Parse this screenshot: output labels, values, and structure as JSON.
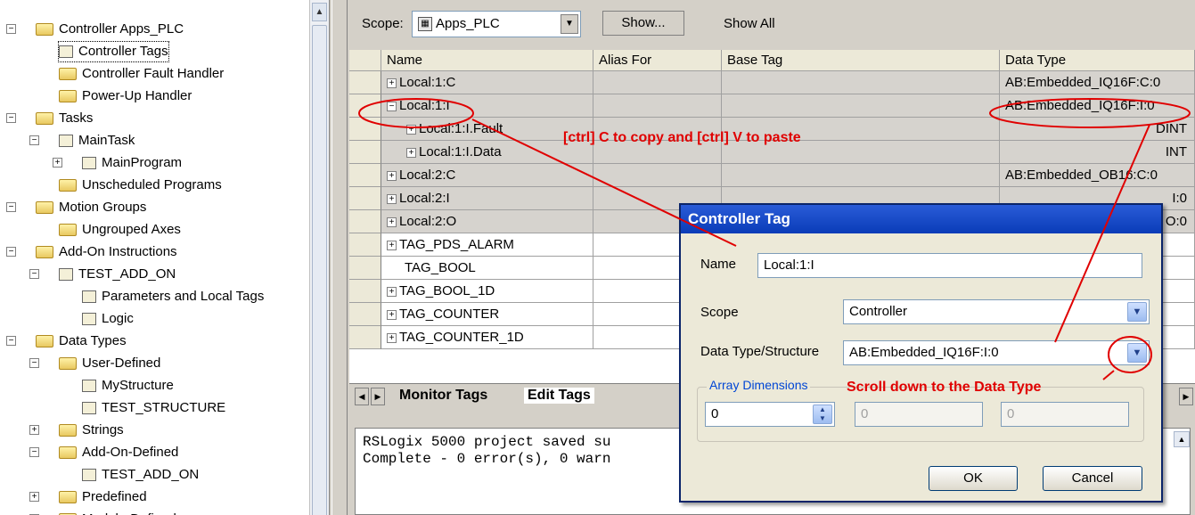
{
  "tree": {
    "items": [
      {
        "label": "Controller Apps_PLC",
        "level": 0,
        "box": "−",
        "icon": "folder-icon"
      },
      {
        "label": "Controller Tags",
        "level": 1,
        "icon": "tag-edit-icon",
        "selected": true
      },
      {
        "label": "Controller Fault Handler",
        "level": 1,
        "icon": "folder-icon"
      },
      {
        "label": "Power-Up Handler",
        "level": 1,
        "icon": "folder-icon"
      },
      {
        "label": "Tasks",
        "level": 0,
        "box": "−",
        "icon": "folder-icon"
      },
      {
        "label": "MainTask",
        "level": 1,
        "box": "−",
        "icon": "task-icon"
      },
      {
        "label": "MainProgram",
        "level": 2,
        "box": "+",
        "icon": "program-icon"
      },
      {
        "label": "Unscheduled Programs",
        "level": 1,
        "icon": "folder-icon"
      },
      {
        "label": "Motion Groups",
        "level": 0,
        "box": "−",
        "icon": "folder-icon"
      },
      {
        "label": "Ungrouped Axes",
        "level": 1,
        "icon": "folder-icon"
      },
      {
        "label": "Add-On Instructions",
        "level": 0,
        "box": "−",
        "icon": "folder-icon"
      },
      {
        "label": "TEST_ADD_ON",
        "level": 1,
        "box": "−",
        "icon": "aoi-icon"
      },
      {
        "label": "Parameters and Local Tags",
        "level": 2,
        "icon": "tag-edit-icon"
      },
      {
        "label": "Logic",
        "level": 2,
        "icon": "logic-icon"
      },
      {
        "label": "Data Types",
        "level": 0,
        "box": "−",
        "icon": "folder-icon"
      },
      {
        "label": "User-Defined",
        "level": 1,
        "box": "−",
        "icon": "datatype-folder-icon"
      },
      {
        "label": "MyStructure",
        "level": 2,
        "icon": "datatype-icon"
      },
      {
        "label": "TEST_STRUCTURE",
        "level": 2,
        "icon": "datatype-icon"
      },
      {
        "label": "Strings",
        "level": 1,
        "box": "+",
        "icon": "datatype-folder-icon"
      },
      {
        "label": "Add-On-Defined",
        "level": 1,
        "box": "−",
        "icon": "datatype-folder-icon"
      },
      {
        "label": "TEST_ADD_ON",
        "level": 2,
        "icon": "datatype-icon"
      },
      {
        "label": "Predefined",
        "level": 1,
        "box": "+",
        "icon": "datatype-folder-icon"
      },
      {
        "label": "Module-Defined",
        "level": 1,
        "box": "+",
        "icon": "datatype-folder-icon"
      }
    ]
  },
  "toolbar": {
    "scope_label": "Scope:",
    "scope_value": "Apps_PLC",
    "show_button": "Show...",
    "show_all": "Show All"
  },
  "grid": {
    "columns": [
      "Name",
      "Alias For",
      "Base Tag",
      "Data Type"
    ],
    "rows": [
      {
        "name": "Local:1:C",
        "box": "+",
        "indent": 0,
        "type": "AB:Embedded_IQ16F:C:0",
        "grey": true
      },
      {
        "name": "Local:1:I",
        "box": "−",
        "indent": 0,
        "type": "AB:Embedded_IQ16F:I:0",
        "grey": true
      },
      {
        "name": "Local:1:I.Fault",
        "box": "+",
        "indent": 1,
        "type": "DINT",
        "grey": true
      },
      {
        "name": "Local:1:I.Data",
        "box": "+",
        "indent": 1,
        "type": "INT",
        "grey": true
      },
      {
        "name": "Local:2:C",
        "box": "+",
        "indent": 0,
        "type": "AB:Embedded_OB16:C:0",
        "grey": true
      },
      {
        "name": "Local:2:I",
        "box": "+",
        "indent": 0,
        "type": "I:0",
        "grey": true
      },
      {
        "name": "Local:2:O",
        "box": "+",
        "indent": 0,
        "type": "O:0",
        "grey": true
      },
      {
        "name": "TAG_PDS_ALARM",
        "box": "+",
        "indent": 0,
        "type": "",
        "grey": false
      },
      {
        "name": "TAG_BOOL",
        "box": "",
        "indent": 0,
        "type": "",
        "grey": false
      },
      {
        "name": "TAG_BOOL_1D",
        "box": "+",
        "indent": 0,
        "type": "",
        "grey": false
      },
      {
        "name": "TAG_COUNTER",
        "box": "+",
        "indent": 0,
        "type": "",
        "grey": false
      },
      {
        "name": "TAG_COUNTER_1D",
        "box": "+",
        "indent": 0,
        "type": "",
        "grey": false
      }
    ]
  },
  "tabs": {
    "monitor": "Monitor Tags",
    "edit": "Edit Tags"
  },
  "output": {
    "line1": "RSLogix 5000 project saved su",
    "line2": "Complete - 0 error(s), 0 warn"
  },
  "dialog": {
    "title": "Controller Tag",
    "name_label": "Name",
    "name_value": "Local:1:I",
    "scope_label": "Scope",
    "scope_value": "Controller",
    "datatype_label": "Data Type/Structure",
    "datatype_value": "AB:Embedded_IQ16F:I:0",
    "array_label": "Array Dimensions",
    "dim1": "0",
    "dim2": "0",
    "dim3": "0",
    "ok": "OK",
    "cancel": "Cancel"
  },
  "annotations": {
    "copy_paste": "[ctrl] C to copy and [ctrl] V to paste",
    "scroll": "Scroll down to the Data Type"
  },
  "colors": {
    "annotation": "#e00000",
    "title_bar": "#0a3cb8",
    "grid_grey": "#d6d3ce"
  }
}
